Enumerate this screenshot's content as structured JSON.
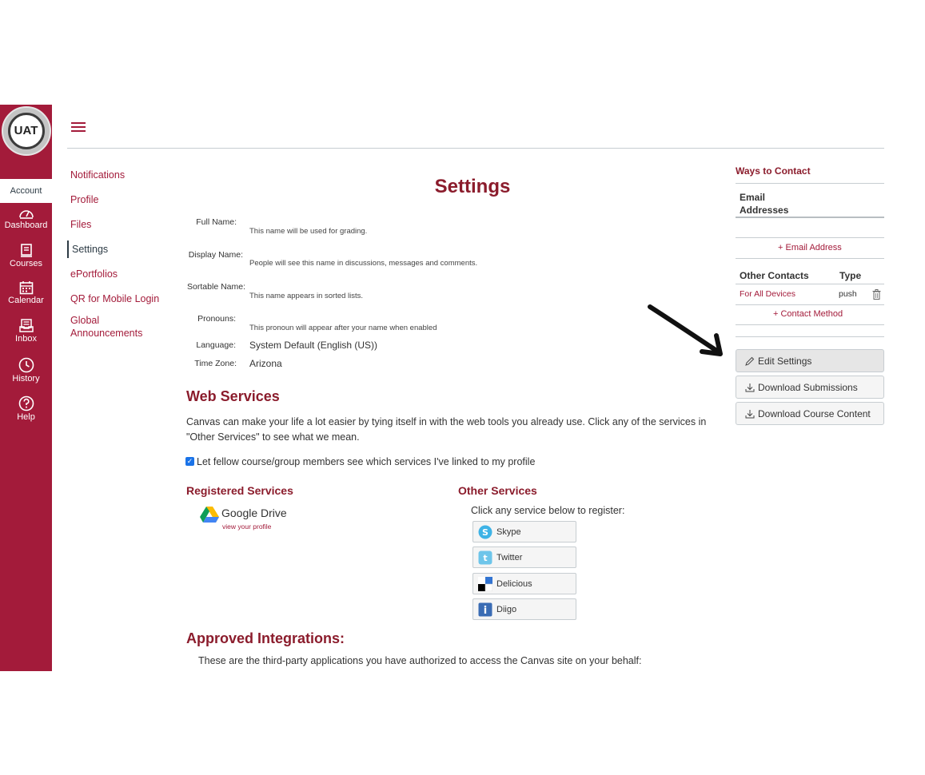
{
  "global_nav": {
    "logo_text": "UAT",
    "account_label": "Account",
    "items": [
      {
        "label": "Dashboard",
        "icon": "dashboard-icon"
      },
      {
        "label": "Courses",
        "icon": "courses-icon"
      },
      {
        "label": "Calendar",
        "icon": "calendar-icon"
      },
      {
        "label": "Inbox",
        "icon": "inbox-icon"
      },
      {
        "label": "History",
        "icon": "history-icon"
      },
      {
        "label": "Help",
        "icon": "help-icon"
      }
    ],
    "brand_color": "#a31b3a"
  },
  "left_menu": {
    "items": [
      {
        "label": "Notifications",
        "active": false
      },
      {
        "label": "Profile",
        "active": false
      },
      {
        "label": "Files",
        "active": false
      },
      {
        "label": "Settings",
        "active": true
      },
      {
        "label": "ePortfolios",
        "active": false
      },
      {
        "label": "QR for Mobile Login",
        "active": false
      },
      {
        "label": "Global Announcements",
        "active": false
      }
    ]
  },
  "main": {
    "title": "Settings",
    "fields": {
      "full_name": {
        "label": "Full Name:",
        "help": "This name will be used for grading."
      },
      "display_name": {
        "label": "Display Name:",
        "help": "People will see this name in discussions, messages and comments."
      },
      "sortable_name": {
        "label": "Sortable Name:",
        "help": "This name appears in sorted lists."
      },
      "pronouns": {
        "label": "Pronouns:",
        "help": "This pronoun will appear after your name when enabled"
      },
      "language": {
        "label": "Language:",
        "value": "System Default (English (US))"
      },
      "time_zone": {
        "label": "Time Zone:",
        "value": "Arizona"
      }
    },
    "web_services": {
      "heading": "Web Services",
      "intro_line1": "Canvas can make your life a lot easier by tying itself in with the web tools you already use. Click any of the services in",
      "intro_line2": "\"Other Services\" to see what we mean.",
      "checkbox_label": "Let fellow course/group members see which services I've linked to my profile",
      "checkbox_checked": true,
      "registered": {
        "heading": "Registered Services",
        "service_name": "Google Drive",
        "service_link": "view your profile"
      },
      "other": {
        "heading": "Other Services",
        "prompt": "Click any service below to register:",
        "services": [
          {
            "label": "Skype",
            "icon": "skype-icon"
          },
          {
            "label": "Twitter",
            "icon": "twitter-icon"
          },
          {
            "label": "Delicious",
            "icon": "delicious-icon"
          },
          {
            "label": "Diigo",
            "icon": "diigo-icon"
          }
        ]
      }
    },
    "integrations": {
      "heading": "Approved Integrations:",
      "text": "These are the third-party applications you have authorized to access the Canvas site on your behalf:"
    }
  },
  "right": {
    "ways_title": "Ways to Contact",
    "email_heading_line1": "Email",
    "email_heading_line2": "Addresses",
    "add_email": "Email Address",
    "other_contacts_heading": "Other Contacts",
    "type_heading": "Type",
    "contacts": [
      {
        "name": "For All Devices",
        "type": "push"
      }
    ],
    "add_contact": "Contact Method",
    "buttons": {
      "edit_settings": "Edit Settings",
      "download_submissions": "Download Submissions",
      "download_course_content": "Download Course Content"
    }
  }
}
